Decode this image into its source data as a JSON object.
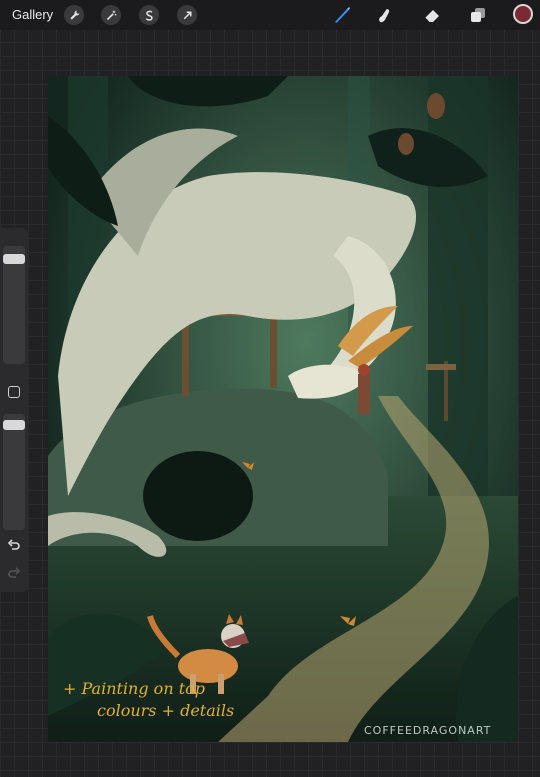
{
  "toolbar": {
    "gallery_label": "Gallery",
    "left_icons": [
      "wrench-icon",
      "magic-wand-icon",
      "selection-icon",
      "transform-arrow-icon"
    ],
    "right_tools": [
      "brush-icon",
      "smudge-icon",
      "eraser-icon",
      "layers-icon"
    ],
    "active_tool": "brush-icon",
    "active_color": "#7a2a33",
    "brush_accent": "#3a8bff"
  },
  "sidebar": {
    "controls": [
      "brush-size-slider",
      "modify-button",
      "opacity-slider",
      "undo-icon",
      "redo-icon"
    ]
  },
  "artwork": {
    "annotation_line1": "+ Painting on top",
    "annotation_line2": "colours + details",
    "signature": "COFFEEDRAGONART",
    "annotation_color": "#e0b12e"
  }
}
